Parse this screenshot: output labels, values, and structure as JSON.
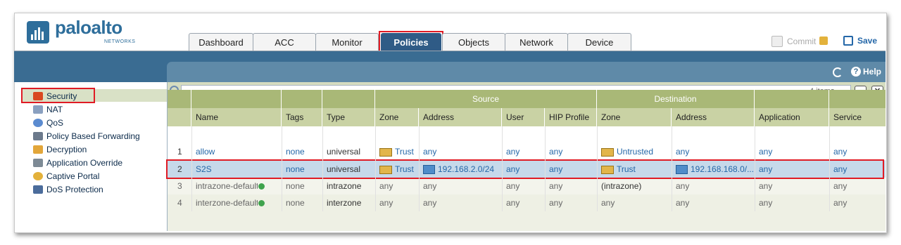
{
  "brand": {
    "name": "paloalto",
    "sub": "NETWORKS"
  },
  "tabs": [
    {
      "label": "Dashboard",
      "active": false
    },
    {
      "label": "ACC",
      "active": false
    },
    {
      "label": "Monitor",
      "active": false
    },
    {
      "label": "Policies",
      "active": true
    },
    {
      "label": "Objects",
      "active": false
    },
    {
      "label": "Network",
      "active": false
    },
    {
      "label": "Device",
      "active": false
    }
  ],
  "header": {
    "commit_label": "Commit",
    "save_label": "Save",
    "help_label": "Help"
  },
  "sidebar": {
    "items": [
      {
        "label": "Security",
        "icon": "security-icon",
        "selected": true
      },
      {
        "label": "NAT",
        "icon": "nat-icon"
      },
      {
        "label": "QoS",
        "icon": "qos-icon"
      },
      {
        "label": "Policy Based Forwarding",
        "icon": "pbf-icon"
      },
      {
        "label": "Decryption",
        "icon": "lock-icon"
      },
      {
        "label": "Application Override",
        "icon": "app-override-icon"
      },
      {
        "label": "Captive Portal",
        "icon": "captive-portal-icon"
      },
      {
        "label": "DoS Protection",
        "icon": "dos-icon"
      }
    ]
  },
  "search": {
    "placeholder": "",
    "count_label": "4 items"
  },
  "table": {
    "group_headers": {
      "source": "Source",
      "destination": "Destination"
    },
    "columns": [
      "Name",
      "Tags",
      "Type",
      "Zone",
      "Address",
      "User",
      "HIP Profile",
      "Zone",
      "Address",
      "Application",
      "Service"
    ],
    "rows": [
      {
        "num": "1",
        "name": "allow",
        "tags": "none",
        "type": "universal",
        "src_zone": "Trust",
        "src_addr": "any",
        "user": "any",
        "hip": "any",
        "dst_zone": "Untrusted",
        "dst_addr": "any",
        "app": "any",
        "service": "any"
      },
      {
        "num": "2",
        "name": "S2S",
        "tags": "none",
        "type": "universal",
        "src_zone": "Trust",
        "src_addr": "192.168.2.0/24",
        "user": "any",
        "hip": "any",
        "dst_zone": "Trust",
        "dst_addr": "192.168.168.0/...",
        "app": "any",
        "service": "any"
      },
      {
        "num": "3",
        "name": "intrazone-default",
        "tags": "none",
        "type": "intrazone",
        "src_zone": "any",
        "src_addr": "any",
        "user": "any",
        "hip": "any",
        "dst_zone": "(intrazone)",
        "dst_addr": "any",
        "app": "any",
        "service": "any"
      },
      {
        "num": "4",
        "name": "interzone-default",
        "tags": "none",
        "type": "interzone",
        "src_zone": "any",
        "src_addr": "any",
        "user": "any",
        "hip": "any",
        "dst_zone": "any",
        "dst_addr": "any",
        "app": "any",
        "service": "any"
      }
    ]
  }
}
